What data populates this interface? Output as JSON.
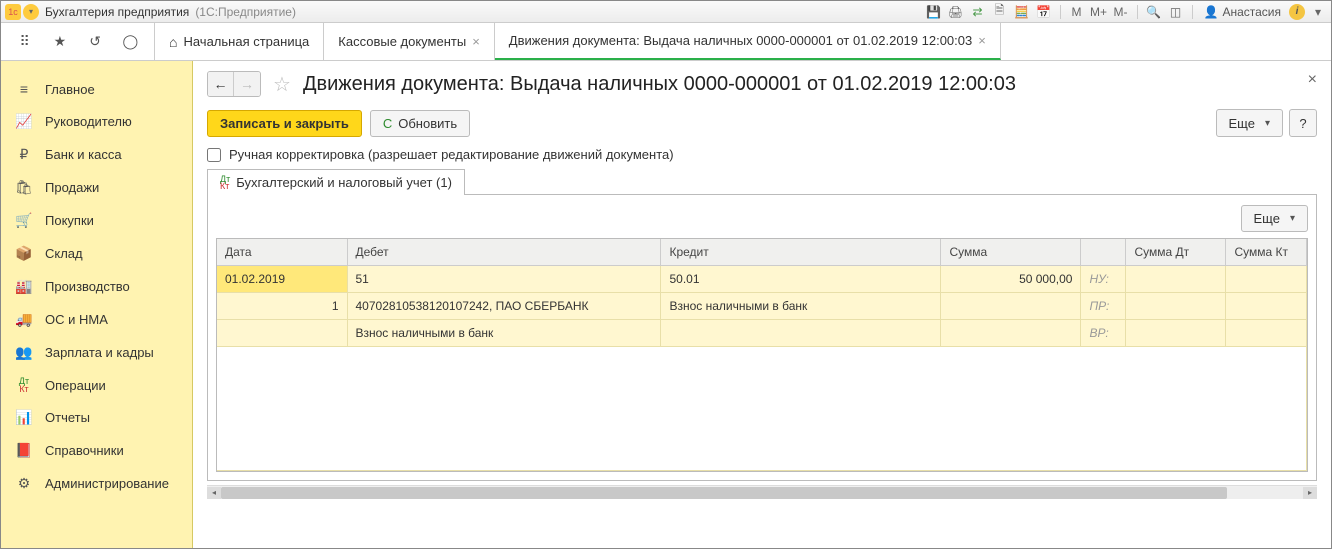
{
  "titlebar": {
    "app_name": "Бухгалтерия предприятия",
    "app_subtitle": "(1С:Предприятие)",
    "user_name": "Анастасия",
    "m_plain": "M",
    "m_plus": "M+",
    "m_minus": "M-"
  },
  "tabrow": {
    "home_label": "Начальная страница",
    "tabs": [
      {
        "label": "Кассовые документы"
      },
      {
        "label": "Движения документа: Выдача наличных 0000-000001 от 01.02.2019 12:00:03"
      }
    ]
  },
  "sidebar": {
    "items": [
      {
        "icon": "≡",
        "label": "Главное"
      },
      {
        "icon": "📈",
        "label": "Руководителю"
      },
      {
        "icon": "₽",
        "label": "Банк и касса"
      },
      {
        "icon": "🛍",
        "label": "Продажи"
      },
      {
        "icon": "🛒",
        "label": "Покупки"
      },
      {
        "icon": "📦",
        "label": "Склад"
      },
      {
        "icon": "🏭",
        "label": "Производство"
      },
      {
        "icon": "🚚",
        "label": "ОС и НМА"
      },
      {
        "icon": "👥",
        "label": "Зарплата и кадры"
      },
      {
        "icon": "Дт",
        "label": "Операции"
      },
      {
        "icon": "📊",
        "label": "Отчеты"
      },
      {
        "icon": "📕",
        "label": "Справочники"
      },
      {
        "icon": "⚙",
        "label": "Администрирование"
      }
    ]
  },
  "doc": {
    "title": "Движения документа: Выдача наличных 0000-000001 от 01.02.2019 12:00:03",
    "save_close": "Записать и закрыть",
    "refresh": "Обновить",
    "more": "Еще",
    "help": "?",
    "manual_edit": "Ручная корректировка (разрешает редактирование движений документа)",
    "inner_tab": "Бухгалтерский и налоговый учет (1)"
  },
  "table": {
    "more": "Еще",
    "headers": {
      "date": "Дата",
      "debit": "Дебет",
      "credit": "Кредит",
      "sum": "Сумма",
      "blank": "",
      "sum_dt": "Сумма Дт",
      "sum_kt": "Сумма Кт"
    },
    "rows": {
      "date": "01.02.2019",
      "debit_account": "51",
      "credit_account": "50.01",
      "amount": "50 000,00",
      "tag_nu": "НУ:",
      "line_no": "1",
      "debit_detail": "40702810538120107242, ПАО СБЕРБАНК",
      "credit_detail": "Взнос наличными в банк",
      "tag_pr": "ПР:",
      "debit_desc": "Взнос наличными в банк",
      "tag_vr": "ВР:"
    }
  }
}
